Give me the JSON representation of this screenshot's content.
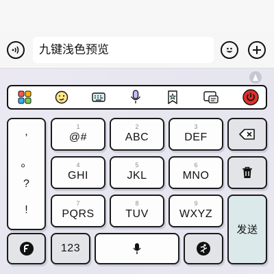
{
  "input_bar": {
    "text": "九键浅色预览"
  },
  "toolbar": {
    "icons": [
      "apps-icon",
      "emoji-face-icon",
      "keyboard-icon",
      "microphone-icon",
      "bookmark-star-icon",
      "clipboard-icon",
      "power-icon"
    ]
  },
  "keyboard": {
    "punctuation": [
      ",",
      "。",
      "?",
      "!"
    ],
    "keys": [
      {
        "num": "1",
        "label": "@#"
      },
      {
        "num": "2",
        "label": "ABC"
      },
      {
        "num": "3",
        "label": "DEF"
      },
      {
        "num": "4",
        "label": "GHI"
      },
      {
        "num": "5",
        "label": "JKL"
      },
      {
        "num": "6",
        "label": "MNO"
      },
      {
        "num": "7",
        "label": "PQRS"
      },
      {
        "num": "8",
        "label": "TUV"
      },
      {
        "num": "9",
        "label": "WXYZ"
      }
    ],
    "send_label": "发送",
    "numbers_label": "123"
  },
  "colors": {
    "keyboard_bg": "#e9e8f1",
    "power_red": "#e0302a",
    "send_bg": "#dbe9ea"
  }
}
